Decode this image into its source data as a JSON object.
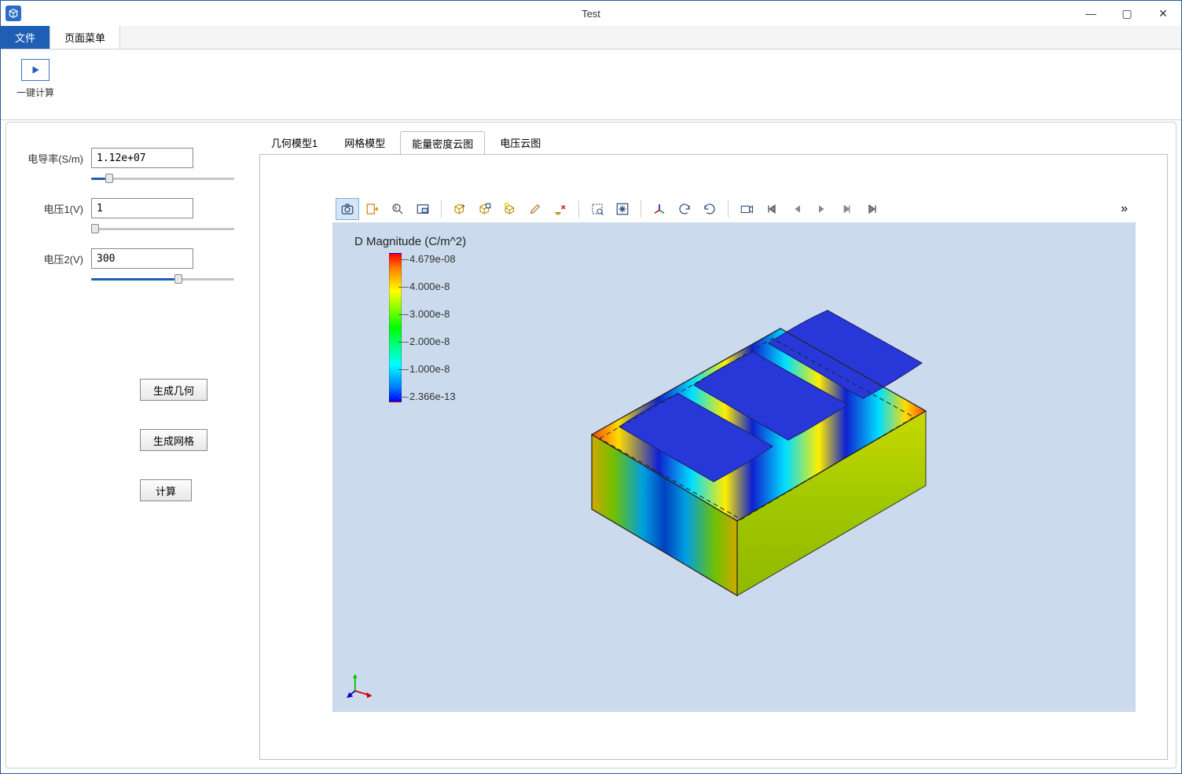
{
  "window": {
    "title": "Test"
  },
  "menu": {
    "file": "文件",
    "page_menu": "页面菜单"
  },
  "ribbon": {
    "compute": "一键计算"
  },
  "params": {
    "conductivity_label": "电导率(S/m)",
    "conductivity_value": "1.12e+07",
    "voltage1_label": "电压1(V)",
    "voltage1_value": "1",
    "voltage2_label": "电压2(V)",
    "voltage2_value": "300"
  },
  "actions": {
    "gen_geometry": "生成几何",
    "gen_mesh": "生成网格",
    "compute": "计算"
  },
  "tabs": {
    "geom": "几何模型1",
    "mesh": "网格模型",
    "energy": "能量密度云图",
    "voltage": "电压云图"
  },
  "legend": {
    "title": "D Magnitude (C/m^2)",
    "ticks": [
      "4.679e-08",
      "4.000e-8",
      "3.000e-8",
      "2.000e-8",
      "1.000e-8",
      "2.366e-13"
    ]
  },
  "toolbar_icons": [
    "camera-icon",
    "export-icon",
    "zoom-lightning-icon",
    "view-region-icon",
    "box-edit-icon",
    "box-layers-icon",
    "lightbulb-box-icon",
    "brush-icon",
    "erase-axis-icon",
    "select-area-icon",
    "fit-view-icon",
    "axes-xyz-icon",
    "rotate-cw-icon",
    "rotate-ccw-icon",
    "film-icon",
    "skip-start-icon",
    "prev-icon",
    "play-icon",
    "next-icon",
    "skip-end-icon"
  ],
  "toolbar_separators_after": [
    3,
    8,
    10,
    13
  ],
  "more_symbol": "»"
}
